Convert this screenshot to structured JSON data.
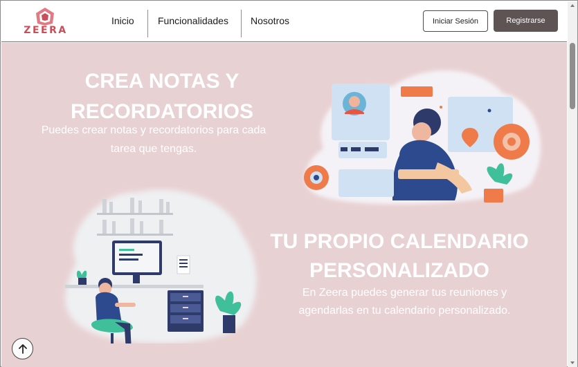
{
  "brand": {
    "name": "ZEERA",
    "primary_color": "#c84f5a"
  },
  "nav": {
    "links": [
      {
        "label": "Inicio"
      },
      {
        "label": "Funcionalidades"
      },
      {
        "label": "Nosotros"
      }
    ],
    "login_label": "Iniciar Sesión",
    "register_label": "Registrarse"
  },
  "hero": {
    "background": "#e8d1d3",
    "section1": {
      "title_line1": "CREA NOTAS Y",
      "title_line2": "RECORDATORIOS",
      "text_line1": "Puedes crear notas y recordatorios para cada",
      "text_line2": "tarea que tengas."
    },
    "section2": {
      "title_line1": "TU PROPIO CALENDARIO",
      "title_line2": "PERSONALIZADO",
      "text_line1": "En Zeera puedes generar tus reuniones y",
      "text_line2": "agendarlas en tu calendario personalizado."
    }
  },
  "icons": {
    "back_to_top": "arrow-up-icon"
  }
}
